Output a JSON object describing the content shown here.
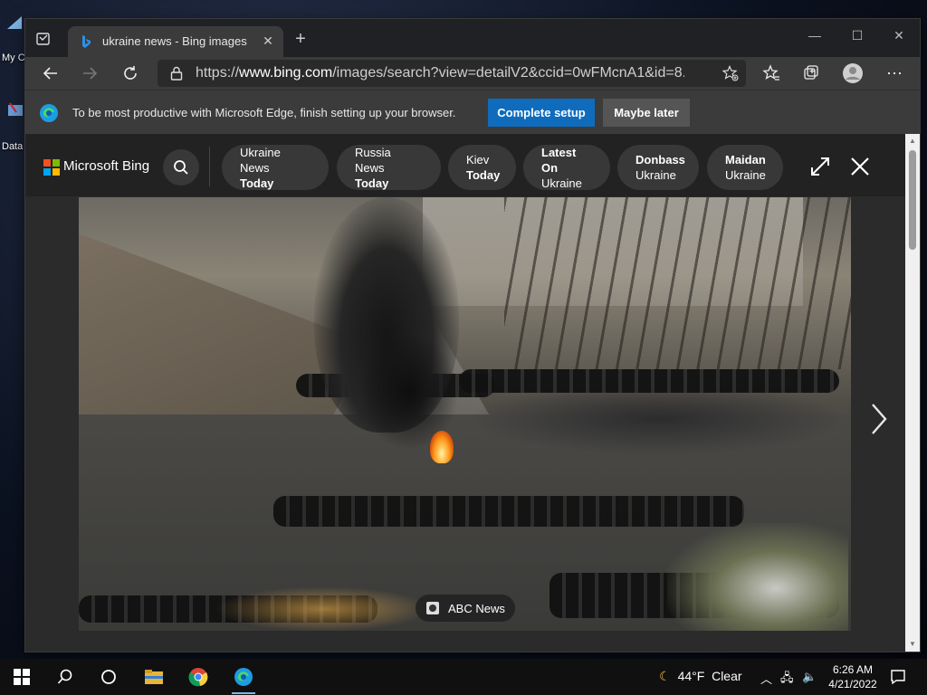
{
  "desktop": {
    "icons": [
      {
        "label": "My C"
      },
      {
        "label": "Data"
      }
    ]
  },
  "browser": {
    "tab": {
      "title": "ukraine news - Bing images"
    },
    "address": {
      "url_prefix": "https://",
      "url_host": "www.bing.com",
      "url_path": "/images/search?view=detailV2&ccid=0wFMcnA1&id=8..."
    },
    "infobar": {
      "message": "To be most productive with Microsoft Edge, finish setting up your browser.",
      "primary_label": "Complete setup",
      "secondary_label": "Maybe later"
    }
  },
  "bing": {
    "brand": "Microsoft Bing",
    "chips": [
      {
        "line1": "Ukraine News",
        "line2": "Today"
      },
      {
        "line1": "Russia News",
        "line2": "Today"
      },
      {
        "line1": "Kiev",
        "line2": "Today"
      },
      {
        "line1": "Latest On",
        "line2": "Ukraine"
      },
      {
        "line1": "Donbass",
        "line2": "Ukraine"
      },
      {
        "line1": "Maidan",
        "line2": "Ukraine"
      }
    ],
    "image_source": "ABC News"
  },
  "taskbar": {
    "weather": {
      "temp": "44°F",
      "condition": "Clear"
    },
    "clock": {
      "time": "6:26 AM",
      "date": "4/21/2022"
    }
  },
  "colors": {
    "accent": "#0f6cbd",
    "logo": [
      "#f25022",
      "#7fba00",
      "#00a4ef",
      "#ffb900"
    ]
  }
}
